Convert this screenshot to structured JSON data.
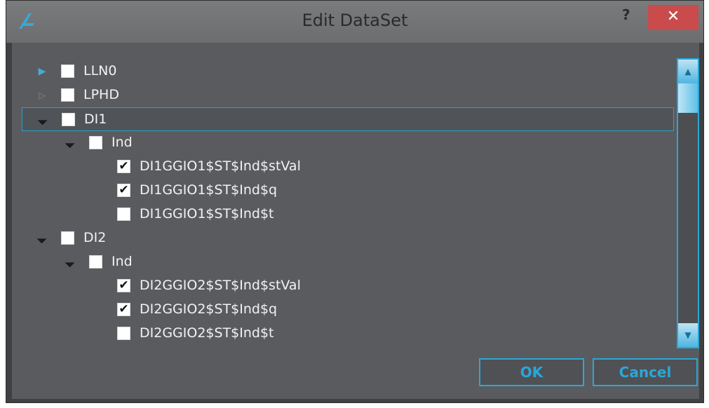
{
  "window": {
    "title": "Edit DataSet",
    "help_label": "?",
    "close_label": "✕"
  },
  "colors": {
    "accent": "#2aa7d9",
    "background": "#5a5b5e",
    "titlebar": "#707173",
    "close": "#c94b4b"
  },
  "tree": [
    {
      "label": "LLN0",
      "level": 0,
      "expander": "collapsed",
      "checked": false,
      "selected": false
    },
    {
      "label": "LPHD",
      "level": 0,
      "expander": "collapsed",
      "checked": false,
      "selected": false
    },
    {
      "label": "DI1",
      "level": 0,
      "expander": "expanded",
      "checked": false,
      "selected": true
    },
    {
      "label": "Ind",
      "level": 1,
      "expander": "expanded",
      "checked": false,
      "selected": false
    },
    {
      "label": "DI1GGIO1$ST$Ind$stVal",
      "level": 2,
      "expander": "none",
      "checked": true,
      "selected": false
    },
    {
      "label": "DI1GGIO1$ST$Ind$q",
      "level": 2,
      "expander": "none",
      "checked": true,
      "selected": false
    },
    {
      "label": "DI1GGIO1$ST$Ind$t",
      "level": 2,
      "expander": "none",
      "checked": false,
      "selected": false
    },
    {
      "label": "DI2",
      "level": 0,
      "expander": "expanded",
      "checked": false,
      "selected": false
    },
    {
      "label": "Ind",
      "level": 1,
      "expander": "expanded",
      "checked": false,
      "selected": false
    },
    {
      "label": "DI2GGIO2$ST$Ind$stVal",
      "level": 2,
      "expander": "none",
      "checked": true,
      "selected": false
    },
    {
      "label": "DI2GGIO2$ST$Ind$q",
      "level": 2,
      "expander": "none",
      "checked": true,
      "selected": false
    },
    {
      "label": "DI2GGIO2$ST$Ind$t",
      "level": 2,
      "expander": "none",
      "checked": false,
      "selected": false
    }
  ],
  "buttons": {
    "ok": "OK",
    "cancel": "Cancel"
  },
  "icons": {
    "app": "app-logo-icon",
    "scroll_up": "scroll-up-arrow-icon",
    "scroll_down": "scroll-down-arrow-icon"
  }
}
